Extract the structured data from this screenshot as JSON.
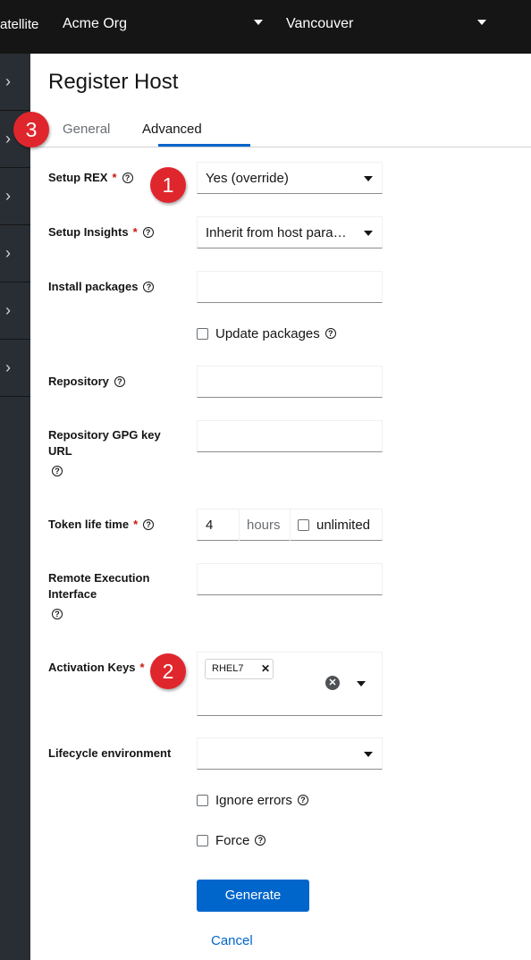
{
  "masthead": {
    "brand": "atellite",
    "organization": "Acme Org",
    "location": "Vancouver"
  },
  "page": {
    "title": "Register Host",
    "tabs": [
      {
        "label": "General",
        "active": false
      },
      {
        "label": "Advanced",
        "active": true
      }
    ]
  },
  "form": {
    "setup_rex": {
      "label": "Setup REX",
      "value": "Yes (override)"
    },
    "setup_insights": {
      "label": "Setup Insights",
      "value": "Inherit from host parameter (yes)"
    },
    "install_packages": {
      "label": "Install packages",
      "value": ""
    },
    "update_packages": {
      "label": "Update packages",
      "checked": false
    },
    "repository": {
      "label": "Repository",
      "value": ""
    },
    "repository_gpg": {
      "label_line1": "Repository GPG key",
      "label_line2": "URL",
      "value": ""
    },
    "token_life_time": {
      "label": "Token life time",
      "value": "4",
      "unit": "hours",
      "unlimited_label": "unlimited",
      "unlimited_checked": false
    },
    "remote_execution_interface": {
      "label_line1": "Remote Execution",
      "label_line2": "Interface",
      "value": ""
    },
    "activation_keys": {
      "label": "Activation Keys",
      "chips": [
        "RHEL7"
      ]
    },
    "lifecycle_environment": {
      "label": "Lifecycle environment",
      "value": ""
    },
    "ignore_errors": {
      "label": "Ignore errors",
      "checked": false
    },
    "force": {
      "label": "Force",
      "checked": false
    },
    "required_mark": "*",
    "help_glyph": "?"
  },
  "actions": {
    "generate": "Generate",
    "cancel": "Cancel"
  },
  "callouts": [
    "1",
    "2",
    "3"
  ],
  "colors": {
    "masthead": "#151515",
    "sidebar": "#292e34",
    "primary": "#0066cc",
    "required": "#c9190b",
    "callout": "#e0262d"
  }
}
